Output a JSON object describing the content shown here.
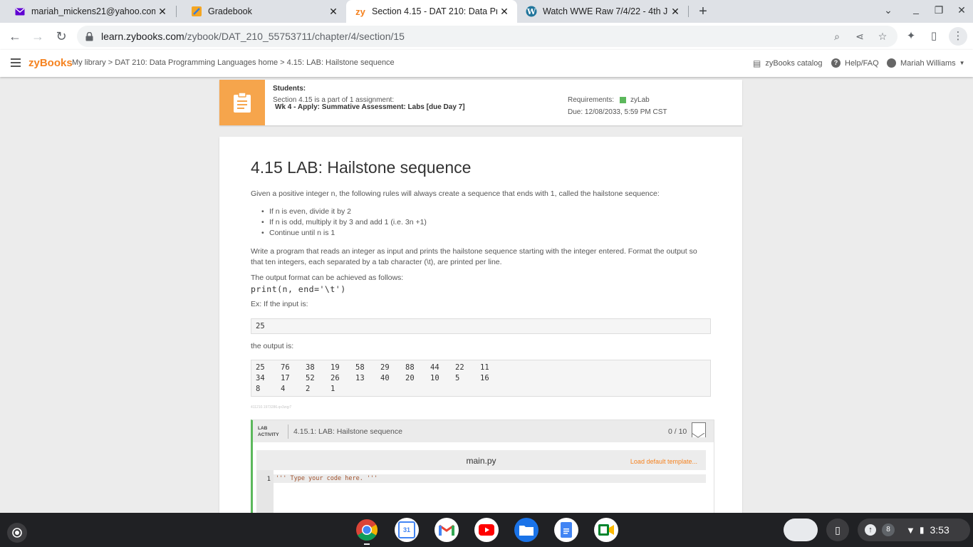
{
  "browser": {
    "tabs": [
      {
        "title": "mariah_mickens21@yahoo.com",
        "icon": "mail-icon",
        "active": false
      },
      {
        "title": "Gradebook",
        "icon": "gradebook-icon",
        "active": false
      },
      {
        "title": "Section 4.15 - DAT 210: Data Pro",
        "icon": "zy-icon",
        "active": true
      },
      {
        "title": "Watch WWE Raw 7/4/22 - 4th Ju",
        "icon": "wordpress-icon",
        "active": false
      }
    ],
    "url_host": "learn.zybooks.com",
    "url_path": "/zybook/DAT_210_55753711/chapter/4/section/15"
  },
  "header": {
    "logo": "zyBooks",
    "breadcrumb": "My library > DAT 210: Data Programming Languages home > 4.15: LAB: Hailstone sequence",
    "catalog": "zyBooks catalog",
    "help": "Help/FAQ",
    "user": "Mariah Williams"
  },
  "notice": {
    "title": "Students:",
    "text": "Section 4.15 is a part of 1 assignment:",
    "assignment": "Wk 4 - Apply: Summative Assessment: Labs [due Day 7]",
    "requirements_label": "Requirements:",
    "requirement": "zyLab",
    "due": "Due: 12/08/2033, 5:59 PM CST"
  },
  "content": {
    "title": "4.15 LAB: Hailstone sequence",
    "intro": "Given a positive integer n, the following rules will always create a sequence that ends with 1, called the hailstone sequence:",
    "rules": [
      "If n is even, divide it by 2",
      "If n is odd, multiply it by 3 and add 1 (i.e. 3n +1)",
      "Continue until n is 1"
    ],
    "task": "Write a program that reads an integer as input and prints the hailstone sequence starting with the integer entered. Format the output so that ten integers, each separated by a tab character (\\t), are printed per line.",
    "format_note": "The output format can be achieved as follows:",
    "code": "print(n, end='\\t')",
    "example_label": "Ex: If the input is:",
    "example_input": "25",
    "output_label": "the output is:",
    "output_rows": [
      [
        "25",
        "76",
        "38",
        "19",
        "58",
        "29",
        "88",
        "44",
        "22",
        "11"
      ],
      [
        "34",
        "17",
        "52",
        "26",
        "13",
        "40",
        "20",
        "10",
        "5",
        "16"
      ],
      [
        "8",
        "4",
        "2",
        "1"
      ]
    ],
    "tiny_id": "411210.1973286.qx3zqy7"
  },
  "lab": {
    "tag_line1": "LAB",
    "tag_line2": "ACTIVITY",
    "title": "4.15.1: LAB: Hailstone sequence",
    "score": "0 / 10",
    "file": "main.py",
    "load_template": "Load default template...",
    "line_number": "1",
    "code": "''' Type your code here. '''"
  },
  "shelf": {
    "apps": [
      "chrome-icon",
      "calendar-icon",
      "gmail-icon",
      "youtube-icon",
      "files-icon",
      "docs-icon",
      "meet-icon"
    ],
    "calendar_day": "31",
    "notification_count": "8",
    "time": "3:53"
  }
}
